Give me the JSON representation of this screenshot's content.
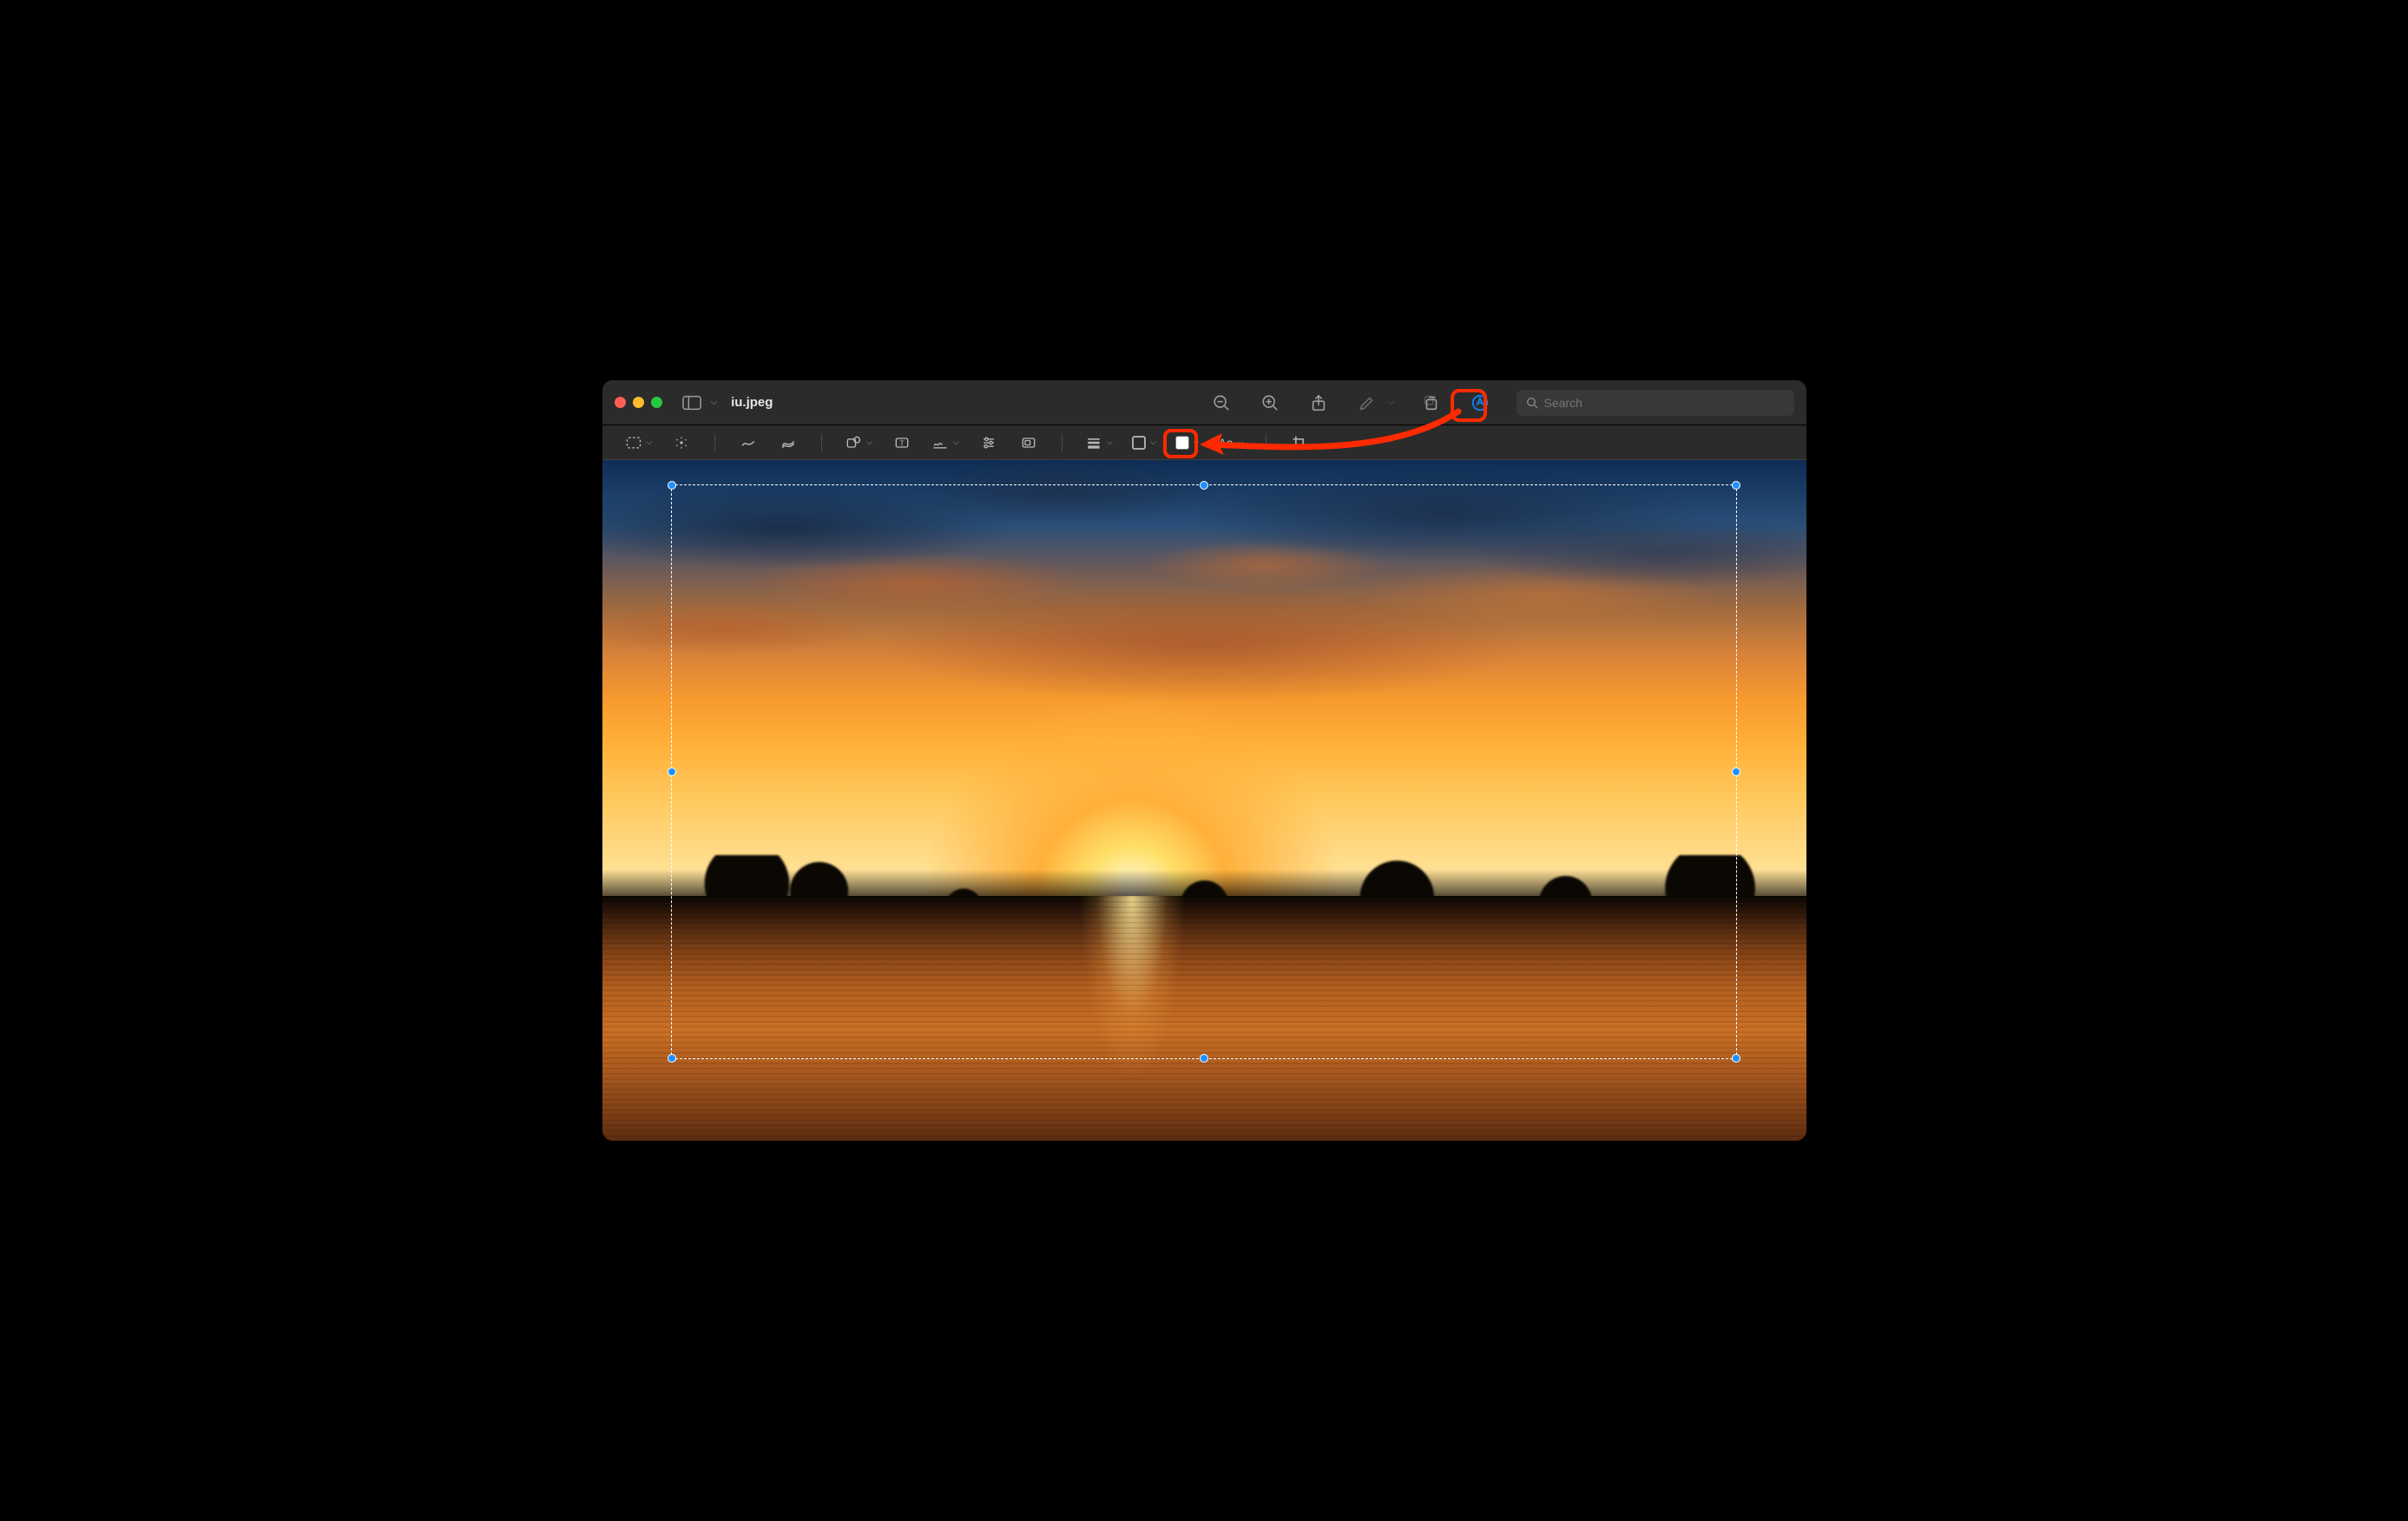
{
  "window": {
    "title": "iu.jpeg"
  },
  "titlebar": {
    "search_placeholder": "Search"
  },
  "markup_bar": {
    "text_style_label": "Aa"
  },
  "colors": {
    "accent_blue": "#0a84ff",
    "annotation_red": "#ff2a00",
    "handle_blue": "#1e90ff"
  }
}
